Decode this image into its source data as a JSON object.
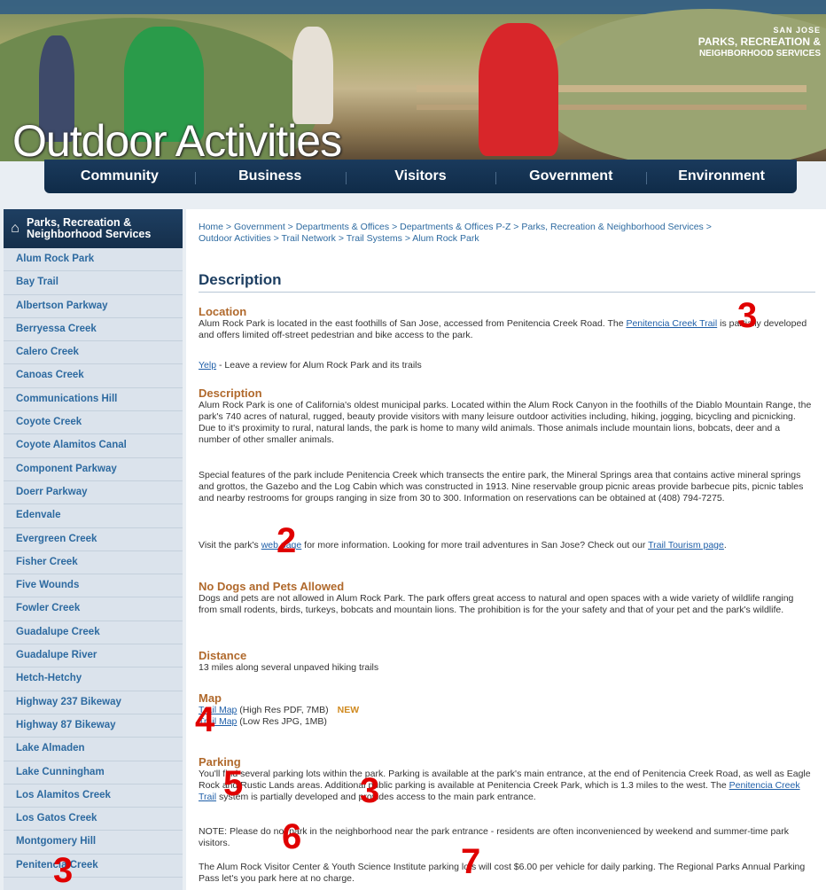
{
  "header": {
    "hero_title": "Outdoor Activities",
    "brand_line1": "SAN JOSE",
    "brand_line2": "PARKS, RECREATION &",
    "brand_line3": "NEIGHBORHOOD SERVICES"
  },
  "nav": [
    "Community",
    "Business",
    "Visitors",
    "Government",
    "Environment"
  ],
  "sidebar": {
    "title_line1": "Parks, Recreation &",
    "title_line2": "Neighborhood Services",
    "items": [
      "Alum Rock Park",
      "Bay Trail",
      "Albertson Parkway",
      "Berryessa Creek",
      "Calero Creek",
      "Canoas Creek",
      "Communications Hill",
      "Coyote Creek",
      "Coyote Alamitos Canal",
      "Component Parkway",
      "Doerr Parkway",
      "Edenvale",
      "Evergreen Creek",
      "Fisher Creek",
      "Five Wounds",
      "Fowler Creek",
      "Guadalupe Creek",
      "Guadalupe River",
      "Hetch-Hetchy",
      "Highway 237 Bikeway",
      "Highway 87 Bikeway",
      "Lake Almaden",
      "Lake Cunningham",
      "Los Alamitos Creek",
      "Los Gatos Creek",
      "Montgomery Hill",
      "Penitencia Creek"
    ]
  },
  "breadcrumb": "Home > Government > Departments & Offices > Departments & Offices P-Z > Parks, Recreation & Neighborhood Services > Outdoor Activities > Trail Network > Trail Systems > Alum Rock Park",
  "main": {
    "title": "Description",
    "location_heading": "Location",
    "location_text1": "Alum Rock Park is located in the east foothills of San Jose, accessed from Penitencia Creek Road.  The ",
    "location_link": "Penitencia Creek Trail",
    "location_text2": " is partially developed and offers limited off-street pedestrian and bike access to the park.",
    "yelp_link": "Yelp",
    "yelp_text": " - Leave a review for Alum Rock Park and its trails",
    "desc_heading": "Description",
    "desc_p1": "Alum Rock Park is one of California's oldest municipal parks.  Located within the Alum Rock Canyon in the foothills of the Diablo Mountain Range, the park's 740 acres of natural, rugged, beauty provide visitors with many leisure outdoor activities including, hiking, jogging, bicycling and picnicking.  Due to it's proximity to rural, natural lands, the park is home to many wild animals.  Those animals include mountain lions, bobcats, deer and a number of other smaller animals.",
    "desc_p2": "Special features of the park include Penitencia Creek which transects the entire park, the Mineral Springs area that contains active mineral springs and grottos, the Gazebo and the Log Cabin which was constructed in 1913. Nine reservable group picnic areas provide barbecue pits, picnic tables and nearby restrooms for groups ranging in size from 30 to 300.  Information on reservations can be obtained at (408) 794-7275.",
    "visit_text1": "Visit the park's ",
    "visit_link": "web page",
    "visit_text2": " for more information.  Looking for more trail adventures in San Jose?  Check out our ",
    "tourism_link": "Trail Tourism page",
    "visit_text3": ".",
    "dogs_heading": "No Dogs and Pets Allowed",
    "dogs_text": "Dogs and pets are not allowed in Alum Rock Park.  The park offers great access to natural and open spaces with a wide variety of wildlife ranging from small rodents, birds, turkeys, bobcats and mountain lions.  The prohibition is for the your safety and that of your pet and the park's wildlife.",
    "distance_heading": "Distance",
    "distance_text": "13 miles along several unpaved hiking trails",
    "map_heading": "Map",
    "map_link1": "Trail Map",
    "map_text1": " (High Res PDF, 7MB)",
    "map_new": "NEW",
    "map_link2": "Trail Map",
    "map_text2": " (Low Res JPG, 1MB)",
    "parking_heading": "Parking",
    "parking_text1": "You'll find several parking lots within the park.  Parking is available at the park's main entrance, at the end of Penitencia Creek Road, as well as Eagle Rock and Rustic Lands areas. Additional public parking is available at Penitencia Creek Park, which is 1.3 miles to the west. The ",
    "parking_link": "Penitencia Creek Trail",
    "parking_text2": " system is partially developed and provides access to the main park entrance.",
    "note_text": "NOTE: Please do not park in the neighborhood near the park entrance - residents are often inconvenienced by weekend and summer-time park visitors.",
    "visitor_text": "The Alum Rock Visitor Center & Youth Science Institute parking lots will cost $6.00 per vehicle for daily parking.  The Regional Parks Annual Parking Pass let's you park here at no charge."
  },
  "annotations": {
    "n3a": "3",
    "n2": "2",
    "n4": "4",
    "n5": "5",
    "n3b": "3",
    "n6": "6",
    "n7": "7",
    "n3c": "3"
  }
}
